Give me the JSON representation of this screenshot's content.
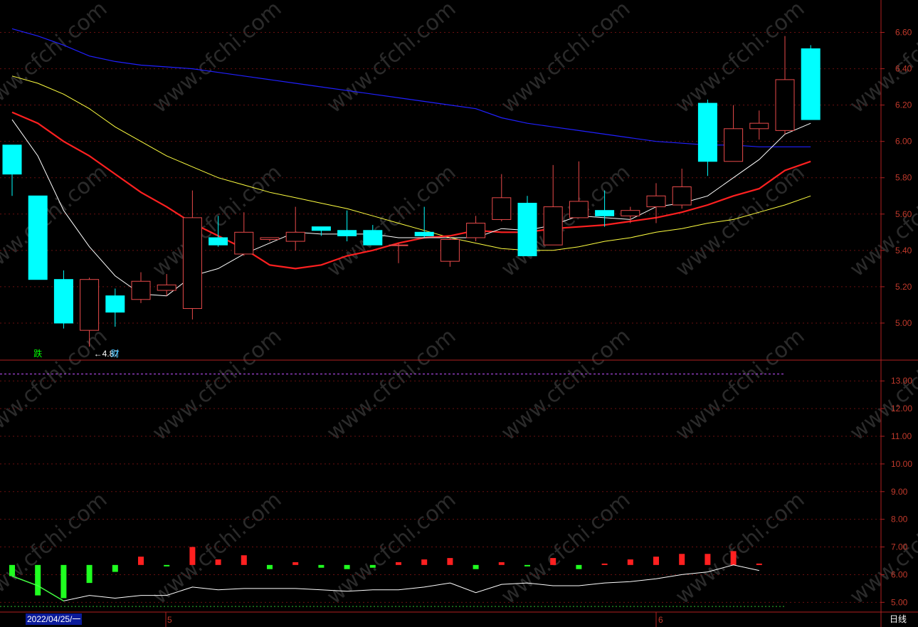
{
  "colors": {
    "up": "#e84a4a",
    "down": "#00ffff",
    "ma5": "#ffffff",
    "ma10": "#ff2020",
    "ma20": "#ffff40",
    "ma60": "#2020ff",
    "grid": "#6a1010",
    "axis": "#b02020",
    "tick_text": "#c0392b"
  },
  "watermark_text": "www.cfchi.com",
  "chart_data": [
    {
      "type": "candlestick",
      "ylim": [
        4.8,
        6.7
      ],
      "y_ticks": [
        "5.00",
        "5.20",
        "5.40",
        "5.60",
        "5.80",
        "6.00",
        "6.20",
        "6.40",
        "6.60"
      ],
      "candles": [
        {
          "o": 5.98,
          "h": 5.98,
          "l": 5.7,
          "c": 5.82
        },
        {
          "o": 5.7,
          "h": 5.7,
          "l": 5.24,
          "c": 5.24
        },
        {
          "o": 5.24,
          "h": 5.29,
          "l": 4.97,
          "c": 5.0
        },
        {
          "o": 4.96,
          "h": 5.25,
          "l": 4.87,
          "c": 5.24
        },
        {
          "o": 5.15,
          "h": 5.19,
          "l": 4.98,
          "c": 5.06
        },
        {
          "o": 5.13,
          "h": 5.28,
          "l": 5.11,
          "c": 5.23
        },
        {
          "o": 5.18,
          "h": 5.27,
          "l": 5.15,
          "c": 5.21
        },
        {
          "o": 5.08,
          "h": 5.73,
          "l": 5.02,
          "c": 5.58
        },
        {
          "o": 5.47,
          "h": 5.59,
          "l": 5.42,
          "c": 5.43
        },
        {
          "o": 5.38,
          "h": 5.61,
          "l": 5.37,
          "c": 5.5
        },
        {
          "o": 5.46,
          "h": 5.47,
          "l": 5.45,
          "c": 5.47
        },
        {
          "o": 5.45,
          "h": 5.64,
          "l": 5.4,
          "c": 5.5
        },
        {
          "o": 5.53,
          "h": 5.53,
          "l": 5.48,
          "c": 5.51
        },
        {
          "o": 5.51,
          "h": 5.62,
          "l": 5.45,
          "c": 5.48
        },
        {
          "o": 5.51,
          "h": 5.54,
          "l": 5.43,
          "c": 5.43
        },
        {
          "o": 5.43,
          "h": 5.44,
          "l": 5.33,
          "c": 5.43
        },
        {
          "o": 5.5,
          "h": 5.64,
          "l": 5.47,
          "c": 5.48
        },
        {
          "o": 5.34,
          "h": 5.47,
          "l": 5.31,
          "c": 5.46
        },
        {
          "o": 5.47,
          "h": 5.59,
          "l": 5.45,
          "c": 5.55
        },
        {
          "o": 5.57,
          "h": 5.82,
          "l": 5.56,
          "c": 5.69
        },
        {
          "o": 5.66,
          "h": 5.7,
          "l": 5.37,
          "c": 5.37
        },
        {
          "o": 5.43,
          "h": 5.87,
          "l": 5.43,
          "c": 5.64
        },
        {
          "o": 5.58,
          "h": 5.89,
          "l": 5.58,
          "c": 5.67
        },
        {
          "o": 5.62,
          "h": 5.73,
          "l": 5.53,
          "c": 5.59
        },
        {
          "o": 5.59,
          "h": 5.64,
          "l": 5.55,
          "c": 5.62
        },
        {
          "o": 5.64,
          "h": 5.77,
          "l": 5.55,
          "c": 5.7
        },
        {
          "o": 5.65,
          "h": 5.85,
          "l": 5.63,
          "c": 5.75
        },
        {
          "o": 6.21,
          "h": 6.23,
          "l": 5.81,
          "c": 5.89
        },
        {
          "o": 5.89,
          "h": 6.2,
          "l": 5.89,
          "c": 6.07
        },
        {
          "o": 6.07,
          "h": 6.17,
          "l": 6.01,
          "c": 6.1
        },
        {
          "o": 6.06,
          "h": 6.58,
          "l": 6.04,
          "c": 6.34
        },
        {
          "o": 6.51,
          "h": 6.53,
          "l": 6.12,
          "c": 6.12
        }
      ],
      "ma5": [
        6.12,
        5.92,
        5.62,
        5.42,
        5.26,
        5.16,
        5.15,
        5.26,
        5.3,
        5.38,
        5.44,
        5.5,
        5.49,
        5.49,
        5.49,
        5.47,
        5.47,
        5.47,
        5.47,
        5.52,
        5.51,
        5.54,
        5.59,
        5.58,
        5.57,
        5.64,
        5.66,
        5.7,
        5.8,
        5.9,
        6.04,
        6.1
      ],
      "ma10": [
        6.16,
        6.1,
        6.0,
        5.92,
        5.82,
        5.72,
        5.64,
        5.55,
        5.48,
        5.41,
        5.32,
        5.3,
        5.32,
        5.37,
        5.4,
        5.44,
        5.47,
        5.48,
        5.51,
        5.5,
        5.5,
        5.52,
        5.53,
        5.54,
        5.56,
        5.58,
        5.61,
        5.65,
        5.7,
        5.74,
        5.84,
        5.89
      ],
      "ma20": [
        6.36,
        6.32,
        6.26,
        6.18,
        6.08,
        6.0,
        5.92,
        5.86,
        5.8,
        5.76,
        5.72,
        5.69,
        5.66,
        5.63,
        5.59,
        5.55,
        5.51,
        5.47,
        5.44,
        5.41,
        5.4,
        5.4,
        5.42,
        5.45,
        5.47,
        5.5,
        5.52,
        5.55,
        5.57,
        5.61,
        5.65,
        5.7
      ],
      "ma60": [
        6.62,
        6.58,
        6.53,
        6.47,
        6.44,
        6.42,
        6.41,
        6.4,
        6.38,
        6.36,
        6.34,
        6.32,
        6.3,
        6.28,
        6.26,
        6.24,
        6.22,
        6.2,
        6.18,
        6.13,
        6.1,
        6.08,
        6.06,
        6.04,
        6.02,
        6.0,
        5.99,
        5.98,
        5.98,
        5.97,
        5.97,
        5.97
      ],
      "low_label": "←4.87",
      "events": [
        {
          "index": 1,
          "text": "跌",
          "color": "#00ff00"
        },
        {
          "index": 4,
          "text": "财",
          "color": "#40c0ff"
        }
      ]
    },
    {
      "type": "bar",
      "ylim": [
        4.7,
        13.7
      ],
      "y_ticks": [
        "5.00",
        "6.00",
        "7.00",
        "8.00",
        "9.00",
        "10.00",
        "11.00",
        "12.00",
        "13.00"
      ],
      "dashed_top": 13.25,
      "dashed_bottom": 4.85,
      "bars": [
        {
          "from": 5.95,
          "to": 6.35,
          "dir": "down"
        },
        {
          "from": 5.25,
          "to": 6.35,
          "dir": "down"
        },
        {
          "from": 5.15,
          "to": 6.35,
          "dir": "down"
        },
        {
          "from": 5.7,
          "to": 6.35,
          "dir": "down"
        },
        {
          "from": 6.1,
          "to": 6.35,
          "dir": "down"
        },
        {
          "from": 6.35,
          "to": 6.65,
          "dir": "up"
        },
        {
          "from": 6.3,
          "to": 6.35,
          "dir": "down"
        },
        {
          "from": 6.35,
          "to": 7.0,
          "dir": "up"
        },
        {
          "from": 6.35,
          "to": 6.55,
          "dir": "up"
        },
        {
          "from": 6.35,
          "to": 6.7,
          "dir": "up"
        },
        {
          "from": 6.2,
          "to": 6.35,
          "dir": "down"
        },
        {
          "from": 6.35,
          "to": 6.45,
          "dir": "up"
        },
        {
          "from": 6.25,
          "to": 6.35,
          "dir": "down"
        },
        {
          "from": 6.2,
          "to": 6.35,
          "dir": "down"
        },
        {
          "from": 6.25,
          "to": 6.35,
          "dir": "down"
        },
        {
          "from": 6.35,
          "to": 6.45,
          "dir": "up"
        },
        {
          "from": 6.35,
          "to": 6.55,
          "dir": "up"
        },
        {
          "from": 6.35,
          "to": 6.6,
          "dir": "up"
        },
        {
          "from": 6.2,
          "to": 6.35,
          "dir": "down"
        },
        {
          "from": 6.35,
          "to": 6.45,
          "dir": "up"
        },
        {
          "from": 6.3,
          "to": 6.35,
          "dir": "down"
        },
        {
          "from": 6.35,
          "to": 6.6,
          "dir": "up"
        },
        {
          "from": 6.2,
          "to": 6.35,
          "dir": "down"
        },
        {
          "from": 6.35,
          "to": 6.4,
          "dir": "up"
        },
        {
          "from": 6.35,
          "to": 6.55,
          "dir": "up"
        },
        {
          "from": 6.35,
          "to": 6.65,
          "dir": "up"
        },
        {
          "from": 6.35,
          "to": 6.75,
          "dir": "up"
        },
        {
          "from": 6.35,
          "to": 6.75,
          "dir": "up"
        },
        {
          "from": 6.35,
          "to": 6.85,
          "dir": "up"
        },
        {
          "from": 6.35,
          "to": 6.4,
          "dir": "up"
        }
      ],
      "line": [
        5.95,
        5.6,
        5.05,
        5.25,
        5.15,
        5.25,
        5.25,
        5.55,
        5.45,
        5.5,
        5.5,
        5.5,
        5.45,
        5.4,
        5.45,
        5.45,
        5.55,
        5.7,
        5.35,
        5.65,
        5.7,
        5.6,
        5.6,
        5.7,
        5.75,
        5.85,
        6.0,
        6.1,
        6.35,
        6.15
      ]
    }
  ],
  "footer": {
    "date_label": "2022/04/25/一",
    "month_5": "5",
    "month_6": "6",
    "period_label": "日线"
  }
}
